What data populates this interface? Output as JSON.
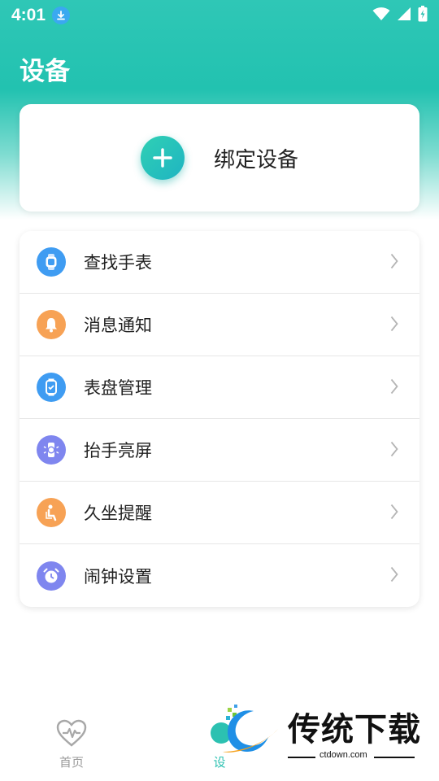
{
  "status_bar": {
    "time": "4:01"
  },
  "header": {
    "title": "设备"
  },
  "bind_card": {
    "label": "绑定设备"
  },
  "menu": {
    "items": [
      {
        "label": "查找手表",
        "icon": "watch-icon",
        "color": "#3f9cf2"
      },
      {
        "label": "消息通知",
        "icon": "bell-icon",
        "color": "#f7a255"
      },
      {
        "label": "表盘管理",
        "icon": "watch-face-icon",
        "color": "#3f9cf2"
      },
      {
        "label": "抬手亮屏",
        "icon": "raise-wrist-icon",
        "color": "#7f86ef"
      },
      {
        "label": "久坐提醒",
        "icon": "sedentary-icon",
        "color": "#f7a255"
      },
      {
        "label": "闹钟设置",
        "icon": "alarm-clock-icon",
        "color": "#7f86ef"
      }
    ]
  },
  "bottom_nav": {
    "home_label": "首页",
    "device_label": "设"
  },
  "watermark": {
    "brand": "传统下载",
    "url": "ctdown.com"
  },
  "colors": {
    "accent": "#22c2b0",
    "inactive": "#9a9a9a"
  }
}
